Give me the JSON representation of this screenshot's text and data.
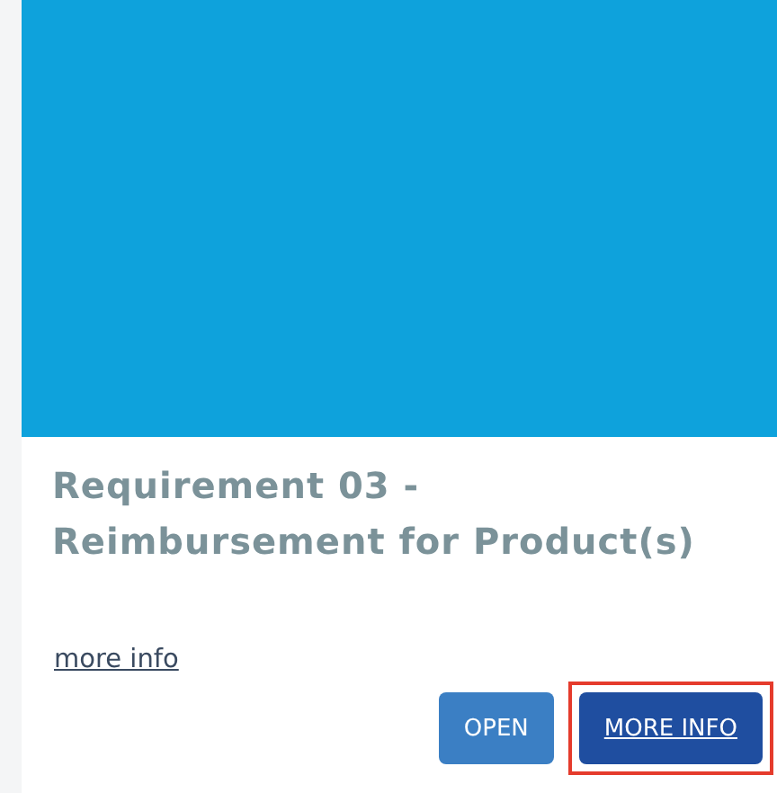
{
  "card": {
    "title_lines": [
      "Requirement 03 -",
      "Reimbursement for Product(s)"
    ],
    "link": "more info",
    "buttons": [
      {
        "label": "OPEN",
        "kind": "secondary",
        "highlighted": false
      },
      {
        "label": "MORE INFO",
        "kind": "primary",
        "highlighted": true
      }
    ]
  }
}
